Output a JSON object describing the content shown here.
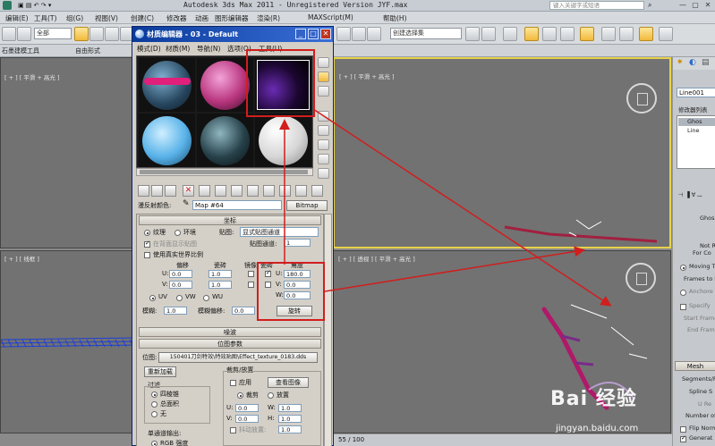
{
  "app": {
    "title": "Autodesk 3ds Max  2011  - Unregistered Version    JYF.max",
    "search_placeholder": "键入关键字或短语"
  },
  "main_menu": [
    "编辑(E)",
    "工具(T)",
    "组(G)",
    "视图(V)",
    "创建(C)",
    "修改器",
    "动画",
    "图形编辑器",
    "渲染(R)",
    "MAXScript(M)",
    "帮助(H)"
  ],
  "toolbar": {
    "selection_filter": "全部",
    "named_selection": "创建选择集"
  },
  "ribbon": {
    "tabs": [
      "石墨建模工具",
      "自由形式"
    ],
    "sub": "建模"
  },
  "viewports": {
    "top_left_label": "[ + ] [ 平滑 + 高光 ]",
    "top_right_label": "[ + ] [ 平滑 + 高光 ]",
    "bottom_left_label": "[ + ] [ 线框 ]",
    "bottom_right_label": "[ + ] [ 透视 ] [ 平滑 + 高光 ]"
  },
  "command_panel": {
    "object_name": "Line001",
    "modifier_list": "修改器列表",
    "stack": [
      "Ghos",
      "Line"
    ],
    "rollout_labels": [
      "Ghos",
      "Not R",
      "For Co",
      "Moving T",
      "Frames to L",
      "Anchore",
      "Specify",
      "Start Frame",
      "End Frame",
      "Mesh",
      "Segments/Fr",
      "Spline S",
      "U Re",
      "Number of",
      "Flip Norm",
      "Generat"
    ]
  },
  "material_editor": {
    "title": "材质编辑器 - 03 - Default",
    "menu": [
      "模式(D)",
      "材质(M)",
      "导航(N)",
      "选项(O)",
      "工具(U)"
    ],
    "reflection_label": "漫反射颜色:",
    "map_name": "Map #64",
    "map_type": "Bitmap",
    "coords": {
      "header": "坐标",
      "texture_label": "纹理",
      "environ_label": "环境",
      "mapping_label": "贴图:",
      "mapping_value": "显式贴图通道",
      "show_back_label": "在背面显示贴图",
      "map_channel_label": "贴图通道:",
      "map_channel_value": "1",
      "real_world_label": "使用真实世界比例",
      "offset_label": "偏移",
      "tiling_label": "瓷砖",
      "mirror_label": "镜像",
      "tile_label": "瓷砖",
      "angle_label": "角度",
      "u_offset": "0.0",
      "v_offset": "0.0",
      "u_tiling": "1.0",
      "v_tiling": "1.0",
      "u_angle": "180.0",
      "v_angle": "0.0",
      "w_angle": "0.0",
      "uv_label": "UV",
      "vw_label": "VW",
      "wu_label": "WU",
      "blur_label": "模糊:",
      "blur_value": "1.0",
      "blur_offset_label": "模糊偏移:",
      "blur_offset_value": "0.0",
      "rotate_button": "旋转"
    },
    "noise_header": "噪波",
    "bitmap_params_header": "位图参数",
    "bitmap_path_label": "位图:",
    "bitmap_path": "150401刀剑特效\\特效贴图\\Effect_texture_0183.dds",
    "reload_button": "重新加载",
    "crop_header": "裁剪/放置",
    "apply_label": "应用",
    "view_image_button": "查看图像",
    "crop_label": "裁剪",
    "place_label": "放置",
    "u_crop": "0.0",
    "v_crop": "0.0",
    "w_crop": "1.0",
    "h_crop": "1.0",
    "jitter_label": "抖动放置:",
    "jitter_value": "1.0",
    "filter_header": "过滤",
    "filter_options": [
      "四棱锥",
      "总面积",
      "无"
    ],
    "mono_output_header": "单通道输出:",
    "rgb_label": "RGB 强度"
  },
  "status": {
    "frame": "55 / 100"
  },
  "watermark": {
    "logo": "Bai 经验",
    "url": "jingyan.baidu.com"
  },
  "colors": {
    "viewport_active_border": "#e6d24a",
    "annotation_red": "#d11e1e",
    "window_title_blue": "#0a3b9b"
  }
}
